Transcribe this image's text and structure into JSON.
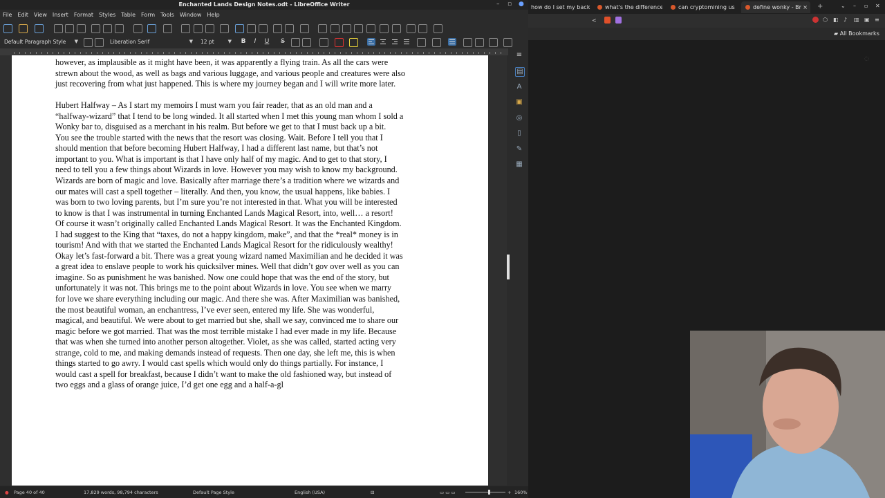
{
  "writer": {
    "title": "Enchanted Lands Design Notes.odt - LibreOffice Writer",
    "menu": [
      "File",
      "Edit",
      "View",
      "Insert",
      "Format",
      "Styles",
      "Table",
      "Form",
      "Tools",
      "Window",
      "Help"
    ],
    "paragraph_style": "Default Paragraph Style",
    "font_name": "Liberation Serif",
    "font_size": "12 pt",
    "format_buttons": {
      "bold": "B",
      "italic": "I",
      "underline": "U",
      "strike": "S"
    },
    "document_lines": [
      "however, as implausible as it might have been, it was apparently a flying train.  As all the cars were",
      "strewn about the wood, as well as bags and various luggage, and various people and creatures were also",
      "just recovering from what just happened.  This is where my journey began and I will write more later.",
      "",
      "Hubert Halfway – As I start my memoirs I must warn you fair reader, that as an old man and a",
      "“halfway-wizard” that I tend to be long winded.  It all started when I met this young man whom I sold a",
      "Wonky bar to, disguised as a merchant in his realm.  But before we get to that I must back up a bit.",
      "You see the trouble started with the news that the resort was closing.  Wait.  Before I tell you that I",
      "should mention that before becoming Hubert Halfway, I had a different last name, but that’s not",
      "important to you.  What is important is that I have only half of my magic.  And to get to that story, I",
      "need to tell you a few things about Wizards in love.  However you may wish to know my background.",
      "Wizards are born of magic and love.  Basically after marriage there’s a tradition where we wizards and",
      "our mates will cast a spell together – literally.  And then, you know, the usual happens, like babies.  I",
      "was born to two loving parents, but I’m sure you’re not interested in that.  What you will be interested",
      "to know is that I was instrumental in turning Enchanted Lands Magical Resort, into, well… a resort!",
      "Of course it wasn’t originally called Enchanted Lands Magical Resort.  It was the Enchanted Kingdom.",
      "I had suggest to the King that “taxes, do not a happy kingdom, make”, and that the *real* money is in",
      "tourism!  And with that we started the Enchanted Lands Magical Resort for the ridiculously wealthy!",
      "Okay let’s fast-forward a bit.  There was a great young wizard named Maximilian and he decided it was",
      "a great idea to enslave people to work his quicksilver mines.  Well that didn’t gov over well as you can",
      "imagine.  So as punishment he was banished.  Now one could hope that was the end of the story, but",
      "unfortunately it was not.  This brings me to the point about Wizards in love.  You see when we marry",
      "for love we share everything including our magic.  And there she was.  After Maximilian was banished,",
      "the most beautiful woman, an enchantress, I’ve ever seen, entered my life.  She was wonderful,",
      "magical, and beautiful.  We were about to get married but she, shall we say, convinced me to share our",
      "magic before we got married.  That was the most terrible mistake I had ever made in my life.  Because",
      "that was when she turned into another person altogether.  Violet, as she was called, started acting very",
      "strange, cold to me, and making demands instead of requests.  Then one day, she left me, this is when",
      "things started to go awry.  I would cast spells which would only do things partially.  For instance, I",
      "would cast a spell for breakfast, because I didn’t want to make the old fashioned way, but instead of",
      "two eggs and a glass of orange juice, I’d get one egg and a half-a-gl"
    ],
    "status": {
      "page": "Page 40 of 40",
      "words": "17,829 words, 98,794 characters",
      "page_style": "Default Page Style",
      "language": "English (USA)",
      "zoom": "160%"
    }
  },
  "browser": {
    "tabs": [
      {
        "label": "how do I set my back",
        "active": false
      },
      {
        "label": "what's the difference",
        "active": false
      },
      {
        "label": "can cryptomining us",
        "active": false
      },
      {
        "label": "define wonky - Br",
        "active": true
      }
    ],
    "new_tab": "+",
    "close_tab": "×",
    "bookmarks_label": "All Bookmarks"
  },
  "colors": {
    "accent": "#3a6ea5",
    "brave_orange": "#d9582b",
    "page": "#ffffff",
    "chrome_dark": "#2b2b2b"
  }
}
